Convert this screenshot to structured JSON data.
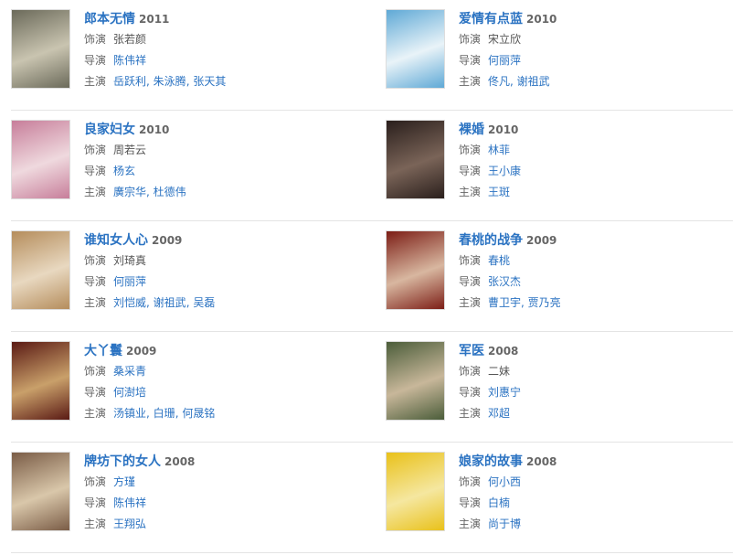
{
  "labels": {
    "role": "饰演",
    "director": "导演",
    "starring": "主演"
  },
  "items": [
    {
      "title": "郎本无情",
      "year": "2011",
      "role": "张若颜",
      "director": "陈伟祥",
      "cast": [
        "岳跃利",
        "朱泳腾",
        "张天其"
      ],
      "role_link": false,
      "poster_colors": [
        "#6b6a5a",
        "#c9c4b0"
      ]
    },
    {
      "title": "爱情有点蓝",
      "year": "2010",
      "role": "宋立欣",
      "director": "何丽萍",
      "cast": [
        "佟凡",
        "谢祖武"
      ],
      "role_link": false,
      "poster_colors": [
        "#5fa9d6",
        "#e9f3f8"
      ]
    },
    {
      "title": "良家妇女",
      "year": "2010",
      "role": "周若云",
      "director": "杨玄",
      "cast": [
        "廣宗华",
        "杜德伟"
      ],
      "role_link": false,
      "poster_colors": [
        "#c77e9a",
        "#efd9de"
      ]
    },
    {
      "title": "裸婚",
      "year": "2010",
      "role": "林菲",
      "director": "王小康",
      "cast": [
        "王斑"
      ],
      "role_link": true,
      "poster_colors": [
        "#2a1f1c",
        "#7a6458"
      ]
    },
    {
      "title": "谁知女人心",
      "year": "2009",
      "role": "刘琦真",
      "director": "何丽萍",
      "cast": [
        "刘恺威",
        "谢祖武",
        "吴磊"
      ],
      "role_link": false,
      "poster_colors": [
        "#b58d5c",
        "#e8d8c0"
      ]
    },
    {
      "title": "春桃的战争",
      "year": "2009",
      "role": "春桃",
      "director": "张汉杰",
      "cast": [
        "曹卫宇",
        "贾乃亮"
      ],
      "role_link": true,
      "poster_colors": [
        "#7c1e16",
        "#d8b7a0"
      ]
    },
    {
      "title": "大丫鬟",
      "year": "2009",
      "role": "桑采青",
      "director": "何澍培",
      "cast": [
        "汤镇业",
        "白珊",
        "何晟铭"
      ],
      "role_link": true,
      "poster_colors": [
        "#5a1a14",
        "#c9a06a"
      ]
    },
    {
      "title": "军医",
      "year": "2008",
      "role": "二妹",
      "director": "刘惠宁",
      "cast": [
        "邓超"
      ],
      "role_link": false,
      "poster_colors": [
        "#4b5d3a",
        "#c8b79a"
      ]
    },
    {
      "title": "牌坊下的女人",
      "year": "2008",
      "role": "方瑾",
      "director": "陈伟祥",
      "cast": [
        "王翔弘"
      ],
      "role_link": true,
      "poster_colors": [
        "#7a5c46",
        "#d9c7aa"
      ]
    },
    {
      "title": "娘家的故事",
      "year": "2008",
      "role": "何小西",
      "director": "白楠",
      "cast": [
        "尚于博"
      ],
      "role_link": true,
      "poster_colors": [
        "#e9c11a",
        "#f5e7a0"
      ]
    }
  ]
}
